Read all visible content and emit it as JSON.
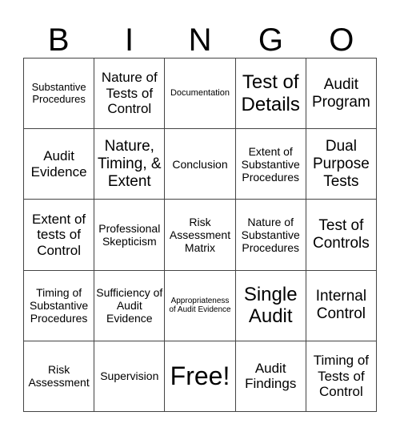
{
  "header": {
    "letters": [
      "B",
      "I",
      "N",
      "G",
      "O"
    ]
  },
  "board": {
    "rows": [
      [
        "Substantive Procedures",
        "Nature of Tests of Control",
        "Documentation",
        "Test of Details",
        "Audit Program"
      ],
      [
        "Audit Evidence",
        "Nature, Timing, & Extent",
        "Conclusion",
        "Extent of Substantive Procedures",
        "Dual Purpose Tests"
      ],
      [
        "Extent of tests of Control",
        "Professional Skepticism",
        "Risk Assessment Matrix",
        "Nature of Substantive Procedures",
        "Test of Controls"
      ],
      [
        "Timing of Substantive Procedures",
        "Sufficiency of Audit Evidence",
        "Appropriateness of Audit Evidence",
        "Single Audit",
        "Internal Control"
      ],
      [
        "Risk Assessment",
        "Supervision",
        "Free!",
        "Audit Findings",
        "Timing of Tests of Control"
      ]
    ]
  }
}
